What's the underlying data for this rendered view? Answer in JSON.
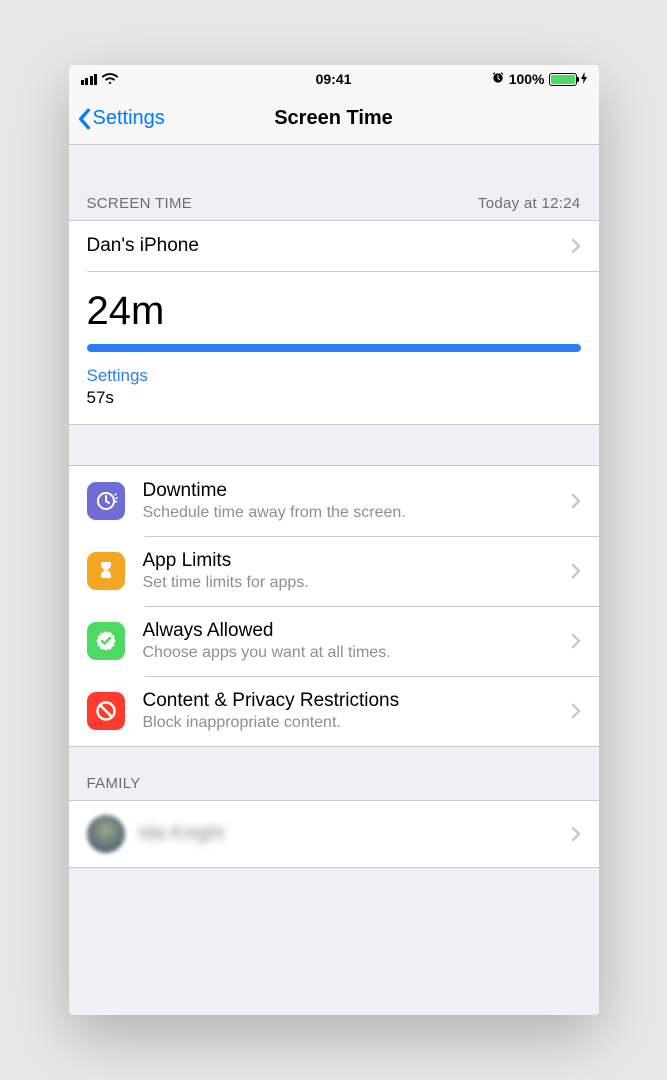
{
  "status": {
    "time": "09:41",
    "battery_pct": "100%",
    "alarm_icon": "alarm-icon",
    "bolt_icon": "charging-icon"
  },
  "nav": {
    "back_label": "Settings",
    "title": "Screen Time"
  },
  "usage": {
    "header_left": "SCREEN TIME",
    "header_right": "Today at 12:24",
    "device_name": "Dan's iPhone",
    "total_time": "24m",
    "category_label": "Settings",
    "category_time": "57s",
    "bar_pct": 100
  },
  "options": [
    {
      "key": "downtime",
      "title": "Downtime",
      "subtitle": "Schedule time away from the screen.",
      "icon": "downtime-icon",
      "color": "downtime"
    },
    {
      "key": "applimits",
      "title": "App Limits",
      "subtitle": "Set time limits for apps.",
      "icon": "hourglass-icon",
      "color": "applimits"
    },
    {
      "key": "allowed",
      "title": "Always Allowed",
      "subtitle": "Choose apps you want at all times.",
      "icon": "check-seal-icon",
      "color": "allowed"
    },
    {
      "key": "restrict",
      "title": "Content & Privacy Restrictions",
      "subtitle": "Block inappropriate content.",
      "icon": "no-sign-icon",
      "color": "restrict"
    }
  ],
  "family": {
    "header": "FAMILY",
    "member_name": "Ida Knight"
  }
}
